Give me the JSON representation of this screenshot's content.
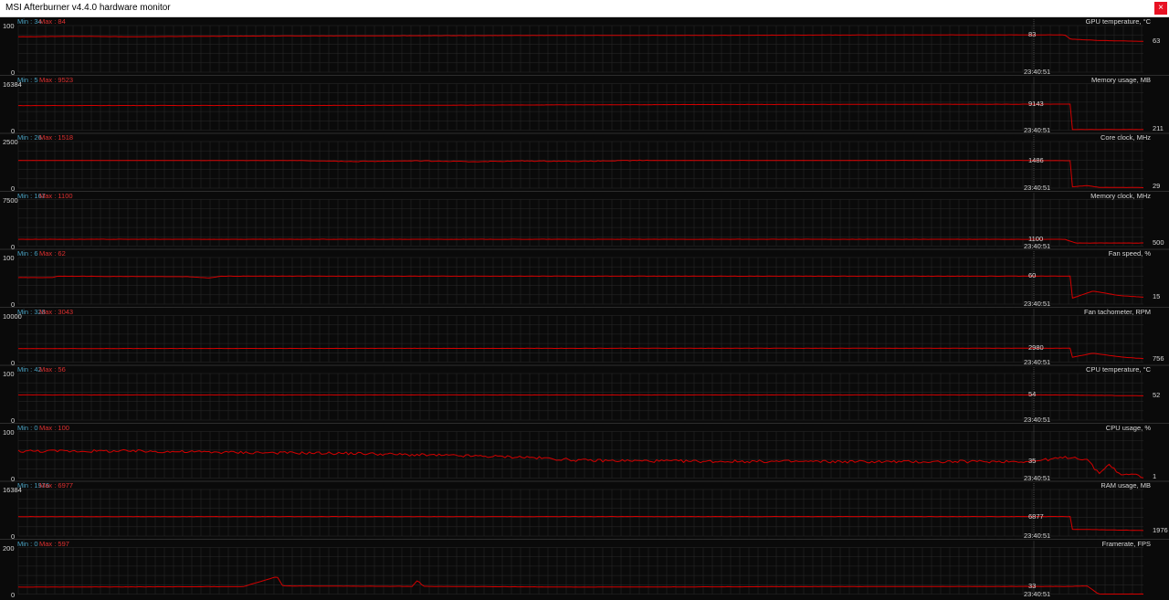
{
  "window": {
    "title": "MSI Afterburner v4.4.0 hardware monitor",
    "close_glyph": "×"
  },
  "colors": {
    "background": "#0a0a0a",
    "grid": "#2a2a2a",
    "separator": "#3a3a3a",
    "trace": "#d40000",
    "cursor_line": "#777777",
    "text": "#d8d8d8",
    "min_label": "#4aa0c0",
    "max_label": "#e03030",
    "close_button": "#e81123"
  },
  "cursor_time": "23:40:51",
  "graphs": [
    {
      "name": "GPU temperature, °C",
      "min_label": "Min : 34",
      "max_label": "Max : 84",
      "scale_top": "100",
      "scale_bottom": "0",
      "range": [
        0,
        100
      ],
      "values": [
        [
          0,
          76
        ],
        [
          0.05,
          77
        ],
        [
          0.1,
          76
        ],
        [
          0.2,
          77.5
        ],
        [
          0.3,
          78
        ],
        [
          0.4,
          78.5
        ],
        [
          0.5,
          79
        ],
        [
          0.6,
          79
        ],
        [
          0.7,
          79.5
        ],
        [
          0.8,
          80
        ],
        [
          0.9,
          80
        ],
        [
          0.93,
          80
        ],
        [
          0.935,
          71
        ],
        [
          0.96,
          68
        ],
        [
          1,
          66
        ]
      ],
      "cursor_value": "83",
      "current_value": "63"
    },
    {
      "name": "Memory usage, MB",
      "min_label": "Min : 5",
      "max_label": "Max : 9523",
      "scale_top": "16384",
      "scale_bottom": "0",
      "range": [
        0,
        16384
      ],
      "values": [
        [
          0,
          8650
        ],
        [
          0.3,
          8700
        ],
        [
          0.5,
          8900
        ],
        [
          0.6,
          9000
        ],
        [
          0.7,
          9050
        ],
        [
          0.8,
          9090
        ],
        [
          0.935,
          9143
        ],
        [
          0.936,
          211
        ],
        [
          1,
          211
        ]
      ],
      "cursor_value": "9143",
      "current_value": "211"
    },
    {
      "name": "Core clock, MHz",
      "min_label": "Min : 26",
      "max_label": "Max : 1518",
      "scale_top": "2500",
      "scale_bottom": "0",
      "range": [
        0,
        2500
      ],
      "values": [
        [
          0,
          1486
        ],
        [
          0.25,
          1480
        ],
        [
          0.3,
          1430
        ],
        [
          0.35,
          1470
        ],
        [
          0.4,
          1420
        ],
        [
          0.45,
          1460
        ],
        [
          0.5,
          1440
        ],
        [
          0.55,
          1486
        ],
        [
          0.7,
          1486
        ],
        [
          0.8,
          1486
        ],
        [
          0.9,
          1486
        ],
        [
          0.935,
          1470
        ],
        [
          0.936,
          60
        ],
        [
          0.95,
          140
        ],
        [
          0.96,
          40
        ],
        [
          1,
          29
        ]
      ],
      "cursor_value": "1486",
      "current_value": "29"
    },
    {
      "name": "Memory clock, MHz",
      "min_label": "Min : 167",
      "max_label": "Max : 1100",
      "scale_top": "7500",
      "scale_bottom": "0",
      "range": [
        0,
        7500
      ],
      "values": [
        [
          0,
          1100
        ],
        [
          0.93,
          1100
        ],
        [
          0.935,
          800
        ],
        [
          0.94,
          500
        ],
        [
          1,
          500
        ]
      ],
      "cursor_value": "1100",
      "current_value": "500"
    },
    {
      "name": "Fan speed, %",
      "min_label": "Min : 6",
      "max_label": "Max : 62",
      "scale_top": "100",
      "scale_bottom": "0",
      "range": [
        0,
        100
      ],
      "values": [
        [
          0,
          57
        ],
        [
          0.03,
          57
        ],
        [
          0.035,
          60
        ],
        [
          0.15,
          59
        ],
        [
          0.17,
          56
        ],
        [
          0.18,
          60
        ],
        [
          0.5,
          60
        ],
        [
          0.8,
          60
        ],
        [
          0.935,
          60
        ],
        [
          0.936,
          12
        ],
        [
          0.955,
          28
        ],
        [
          0.98,
          18
        ],
        [
          1,
          15
        ]
      ],
      "cursor_value": "60",
      "current_value": "15"
    },
    {
      "name": "Fan tachometer, RPM",
      "min_label": "Min : 328",
      "max_label": "Max : 3043",
      "scale_top": "10000",
      "scale_bottom": "0",
      "range": [
        0,
        10000
      ],
      "values": [
        [
          0,
          2900
        ],
        [
          0.1,
          2920
        ],
        [
          0.3,
          2950
        ],
        [
          0.5,
          2960
        ],
        [
          0.7,
          2970
        ],
        [
          0.935,
          2980
        ],
        [
          0.936,
          1000
        ],
        [
          0.955,
          1900
        ],
        [
          0.98,
          1100
        ],
        [
          1,
          756
        ]
      ],
      "cursor_value": "2980",
      "current_value": "756"
    },
    {
      "name": "CPU temperature, °C",
      "min_label": "Min : 42",
      "max_label": "Max : 56",
      "scale_top": "100",
      "scale_bottom": "0",
      "range": [
        0,
        100
      ],
      "values": [
        [
          0,
          54
        ],
        [
          0.2,
          54
        ],
        [
          0.4,
          54
        ],
        [
          0.6,
          54
        ],
        [
          0.8,
          54
        ],
        [
          0.935,
          54
        ],
        [
          1,
          52
        ]
      ],
      "cursor_value": "54",
      "current_value": "52"
    },
    {
      "name": "CPU usage, %",
      "min_label": "Min : 0",
      "max_label": "Max : 100",
      "scale_top": "100",
      "scale_bottom": "0",
      "range": [
        0,
        100
      ],
      "values": [
        [
          0,
          58
        ],
        [
          0.1,
          58
        ],
        [
          0.2,
          55
        ],
        [
          0.3,
          53
        ],
        [
          0.35,
          50
        ],
        [
          0.45,
          45
        ],
        [
          0.5,
          38
        ],
        [
          0.6,
          36
        ],
        [
          0.8,
          35
        ],
        [
          0.9,
          36
        ],
        [
          0.935,
          45
        ],
        [
          0.95,
          40
        ],
        [
          0.96,
          10
        ],
        [
          0.97,
          30
        ],
        [
          0.98,
          5
        ],
        [
          0.99,
          10
        ],
        [
          1,
          1
        ]
      ],
      "cursor_value": "35",
      "current_value": "1"
    },
    {
      "name": "RAM usage, MB",
      "min_label": "Min : 1976",
      "max_label": "Max : 6977",
      "scale_top": "16384",
      "scale_bottom": "0",
      "range": [
        0,
        16384
      ],
      "values": [
        [
          0,
          6860
        ],
        [
          0.4,
          6870
        ],
        [
          0.6,
          6877
        ],
        [
          0.8,
          6877
        ],
        [
          0.935,
          6877
        ],
        [
          0.936,
          2400
        ],
        [
          1,
          1976
        ]
      ],
      "cursor_value": "6877",
      "current_value": "1976"
    },
    {
      "name": "Framerate, FPS",
      "min_label": "Min : 0",
      "max_label": "Max : 597",
      "scale_top": "200",
      "scale_bottom": "0",
      "range": [
        0,
        200
      ],
      "values": [
        [
          0,
          30
        ],
        [
          0.2,
          32
        ],
        [
          0.23,
          75
        ],
        [
          0.235,
          35
        ],
        [
          0.35,
          33
        ],
        [
          0.355,
          60
        ],
        [
          0.36,
          33
        ],
        [
          0.5,
          30
        ],
        [
          0.7,
          32
        ],
        [
          0.935,
          33
        ],
        [
          0.95,
          35
        ],
        [
          0.96,
          0
        ],
        [
          1,
          0
        ]
      ],
      "cursor_value": "33",
      "current_value": ""
    }
  ]
}
